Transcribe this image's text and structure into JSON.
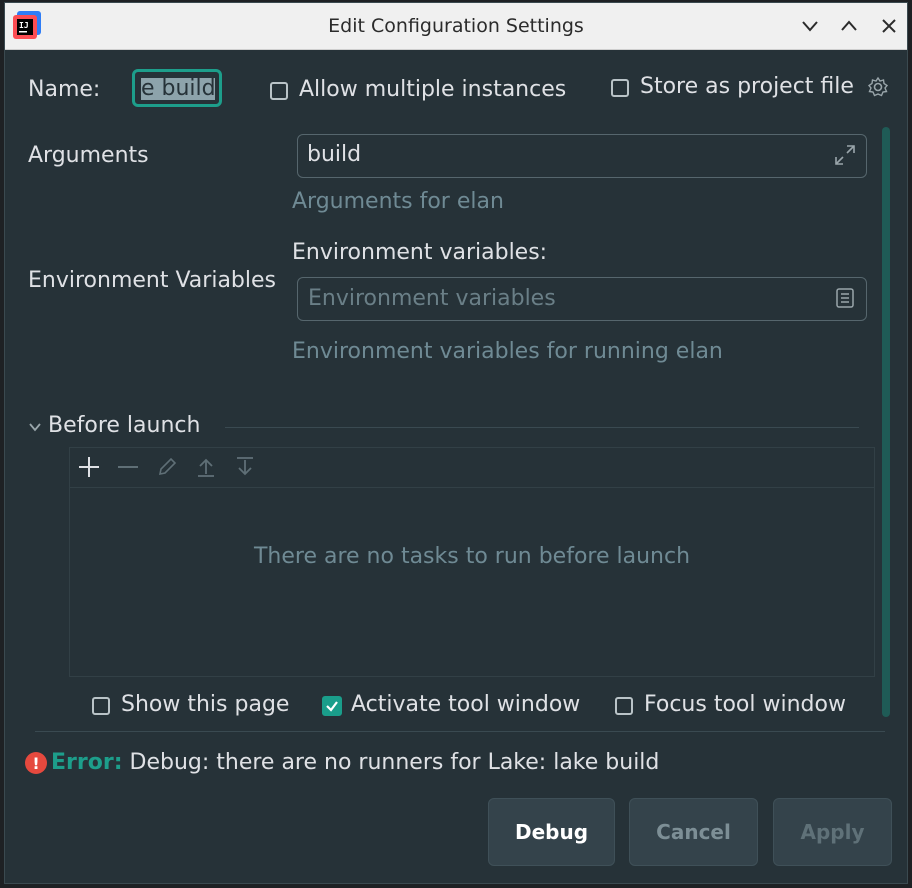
{
  "window": {
    "title": "Edit Configuration Settings",
    "app_icon": "intellij-logo-icon",
    "controls": [
      "minimize-icon",
      "maximize-icon",
      "close-icon"
    ]
  },
  "name_row": {
    "label": "Name:",
    "value": "e build",
    "allow_multiple_label": "Allow multiple instances",
    "allow_multiple_checked": false,
    "store_project_label": "Store as project file",
    "store_project_checked": false
  },
  "arguments": {
    "label": "Arguments",
    "value": "build",
    "hint": "Arguments for elan"
  },
  "environment": {
    "label": "Environment Variables",
    "field_label": "Environment variables:",
    "placeholder": "Environment variables",
    "hint": "Environment variables for running elan"
  },
  "before_launch": {
    "title": "Before launch",
    "toolbar": [
      "add-icon",
      "remove-icon",
      "edit-icon",
      "move-up-icon",
      "move-down-icon"
    ],
    "empty_text": "There are no tasks to run before launch",
    "show_page_label": "Show this page",
    "show_page_checked": false,
    "activate_tool_label": "Activate tool window",
    "activate_tool_checked": true,
    "focus_tool_label": "Focus tool window",
    "focus_tool_checked": false
  },
  "error": {
    "prefix": "Error:",
    "message": "Debug: there are no runners for Lake: lake build"
  },
  "buttons": {
    "debug": "Debug",
    "cancel": "Cancel",
    "apply": "Apply"
  },
  "colors": {
    "accent": "#1d9e8b",
    "background": "#263238",
    "error": "#e5493e"
  }
}
